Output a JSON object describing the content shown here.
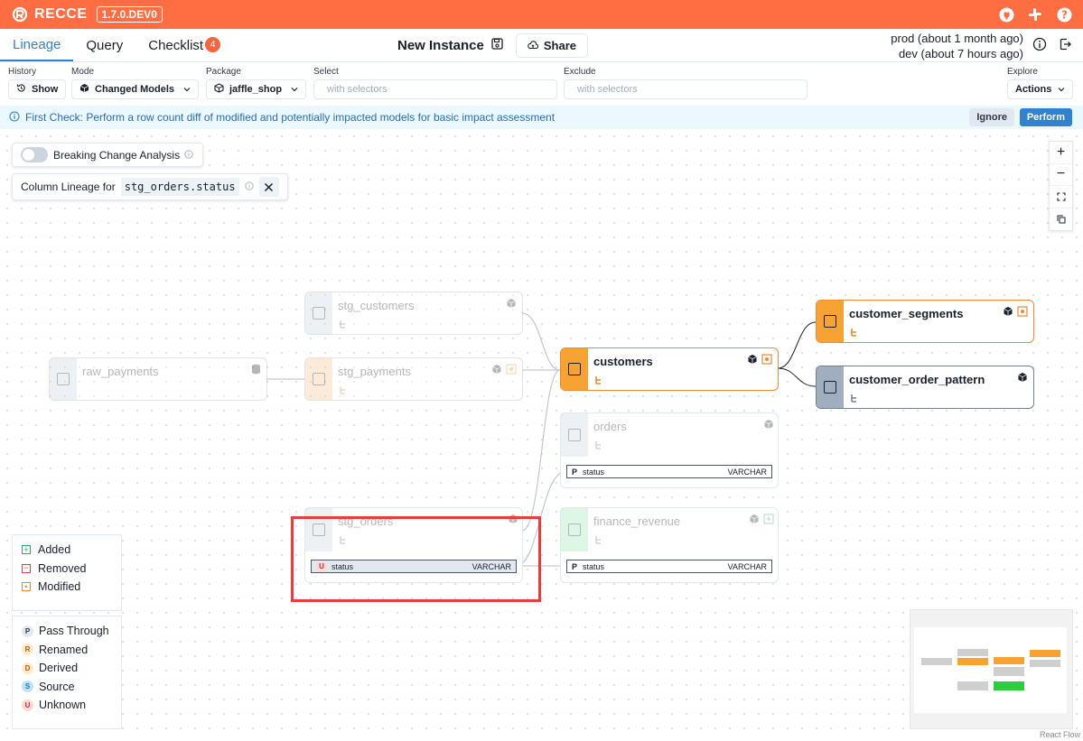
{
  "topbar": {
    "brand": "RECCE",
    "version": "1.7.0.DEV0",
    "color": "#ff6e42"
  },
  "nav": {
    "tabs": [
      {
        "label": "Lineage",
        "active": true
      },
      {
        "label": "Query",
        "active": false
      },
      {
        "label": "Checklist",
        "badge": "4",
        "active": false
      }
    ],
    "instance_title": "New Instance",
    "share_label": "Share",
    "env_prod": "prod (about 1 month ago)",
    "env_dev": "dev (about 7 hours ago)"
  },
  "filters": {
    "history_label": "History",
    "history_button": "Show",
    "mode_label": "Mode",
    "mode_value": "Changed Models",
    "package_label": "Package",
    "package_value": "jaffle_shop",
    "select_label": "Select",
    "select_placeholder": "with selectors",
    "exclude_label": "Exclude",
    "exclude_placeholder": "with selectors",
    "explore_label": "Explore",
    "actions_label": "Actions"
  },
  "banner": {
    "text": "First Check: Perform a row count diff of modified and potentially impacted models for basic impact assessment",
    "ignore": "Ignore",
    "perform": "Perform"
  },
  "canvas": {
    "breaking_change_label": "Breaking Change Analysis",
    "column_lineage_label": "Column Lineage for",
    "column_lineage_target": "stg_orders.status"
  },
  "nodes": {
    "raw_payments": "raw_payments",
    "stg_customers": "stg_customers",
    "stg_payments": "stg_payments",
    "stg_orders": "stg_orders",
    "customers": "customers",
    "orders": "orders",
    "finance_revenue": "finance_revenue",
    "customer_segments": "customer_segments",
    "customer_order_pattern": "customer_order_pattern"
  },
  "columns": {
    "stg_orders": {
      "tag": "U",
      "name": "status",
      "type": "VARCHAR"
    },
    "orders": {
      "tag": "P",
      "name": "status",
      "type": "VARCHAR"
    },
    "finance_revenue": {
      "tag": "P",
      "name": "status",
      "type": "VARCHAR"
    }
  },
  "legend_change": [
    {
      "symbol": "+",
      "label": "Added",
      "color": "#38a169"
    },
    {
      "symbol": "−",
      "label": "Removed",
      "color": "#e53e3e"
    },
    {
      "symbol": "•",
      "label": "Modified",
      "color": "#ed8936"
    }
  ],
  "legend_transform": [
    {
      "letter": "P",
      "label": "Pass Through",
      "bg": "#e2e8f0",
      "fg": "#2d3748"
    },
    {
      "letter": "R",
      "label": "Renamed",
      "bg": "#feebc8",
      "fg": "#c05621"
    },
    {
      "letter": "D",
      "label": "Derived",
      "bg": "#feebc8",
      "fg": "#c05621"
    },
    {
      "letter": "S",
      "label": "Source",
      "bg": "#bee3f8",
      "fg": "#2b6cb0"
    },
    {
      "letter": "U",
      "label": "Unknown",
      "bg": "#fed7d7",
      "fg": "#c53030"
    }
  ],
  "footer": {
    "reactflow": "React Flow"
  }
}
